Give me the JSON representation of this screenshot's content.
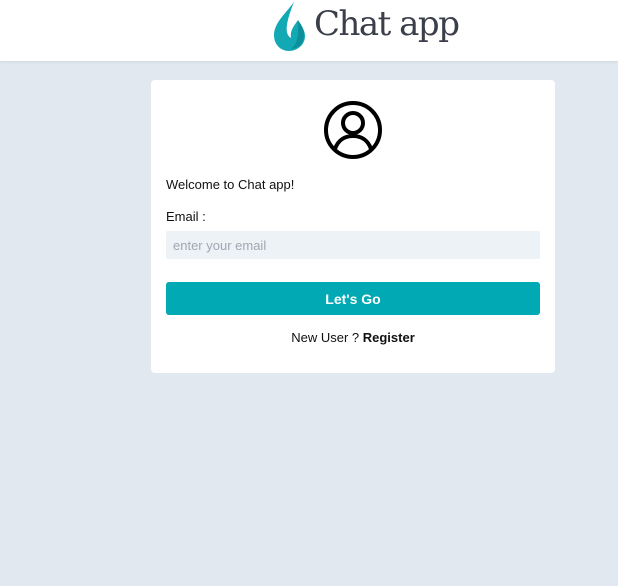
{
  "header": {
    "brand_name": "Chat app",
    "logo_icon": "flame-drop-icon",
    "logo_color": "#12a9b4"
  },
  "login_card": {
    "avatar_icon": "user-circle-icon",
    "welcome_text": "Welcome to Chat app!",
    "email_label": "Email :",
    "email_value": "",
    "email_placeholder": "enter your email",
    "submit_label": "Let's Go",
    "new_user_text": "New User ?",
    "register_label": "Register",
    "accent_color": "#00a9b4"
  },
  "page_background": "#e2e8f0"
}
